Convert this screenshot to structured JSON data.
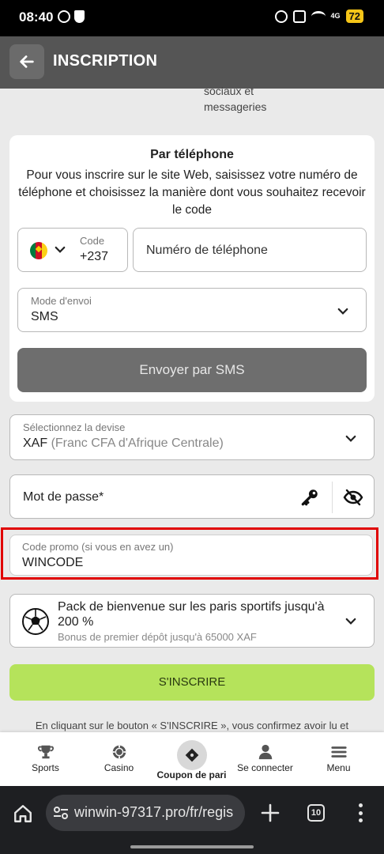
{
  "status_bar": {
    "time": "08:40",
    "network": "4G",
    "battery": "72"
  },
  "header": {
    "title": "INSCRIPTION"
  },
  "partial_text": {
    "line1": "sociaux et",
    "line2": "messageries"
  },
  "phone_card": {
    "title": "Par téléphone",
    "description": "Pour vous inscrire sur le site Web, saisissez votre numéro de téléphone et choisissez la manière dont vous souhaitez recevoir le code",
    "code_label": "Code",
    "code_value": "+237",
    "phone_placeholder": "Numéro de téléphone",
    "mode_label": "Mode d'envoi",
    "mode_value": "SMS",
    "send_button": "Envoyer par SMS"
  },
  "currency": {
    "label": "Sélectionnez la devise",
    "code": "XAF",
    "name": "(Franc CFA d'Afrique Centrale)"
  },
  "password": {
    "placeholder": "Mot de passe*"
  },
  "promo": {
    "label": "Code promo (si vous en avez un)",
    "value": "WINCODE"
  },
  "bonus": {
    "title": "Pack de bienvenue sur les paris sportifs jusqu'à 200 %",
    "subtitle": "Bonus de premier dépôt jusqu'à 65000 XAF"
  },
  "register_button": "S'INSCRIRE",
  "terms_text": "En cliquant sur le bouton « S'INSCRIRE », vous confirmez avoir lu et",
  "bottom_nav": {
    "sports": "Sports",
    "casino": "Casino",
    "coupon": "Coupon de pari",
    "login": "Se connecter",
    "menu": "Menu"
  },
  "browser": {
    "url": "winwin-97317.pro/fr/regis",
    "tab_count": "10"
  },
  "colors": {
    "header_bg": "#555555",
    "register_green": "#b5e35b",
    "highlight_red": "#e00000",
    "send_button_gray": "#6e6e6e"
  }
}
